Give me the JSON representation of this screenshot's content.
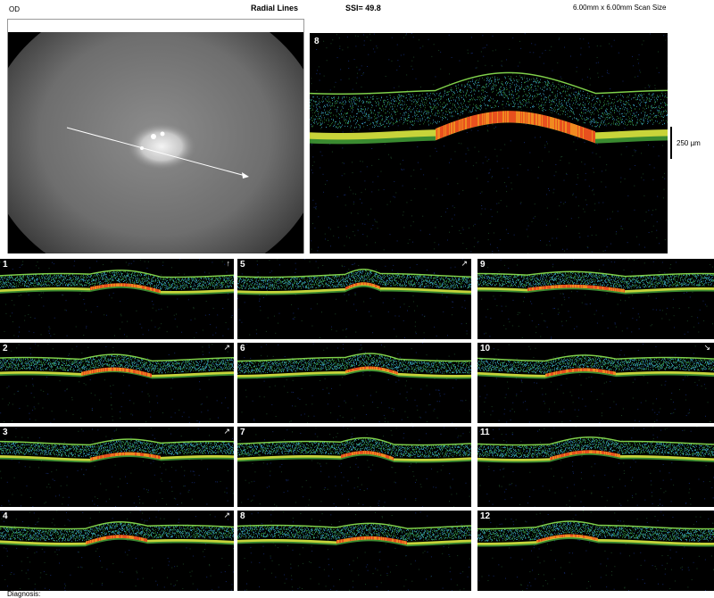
{
  "header": {
    "eye": "OD",
    "protocol": "Radial Lines",
    "ssi": "SSI= 49.8",
    "scan_size": "6.00mm x 6.00mm Scan Size"
  },
  "main_scan": {
    "label": "8"
  },
  "scale": {
    "label": "250 µm"
  },
  "thumbnails": [
    {
      "label": "1",
      "arrow": "↑"
    },
    {
      "label": "2",
      "arrow": "↗"
    },
    {
      "label": "3",
      "arrow": "↗"
    },
    {
      "label": "4",
      "arrow": "↗"
    },
    {
      "label": "5",
      "arrow": "↗"
    },
    {
      "label": "6",
      "arrow": ""
    },
    {
      "label": "7",
      "arrow": ""
    },
    {
      "label": "8",
      "arrow": ""
    },
    {
      "label": "9",
      "arrow": ""
    },
    {
      "label": "10",
      "arrow": "↘"
    },
    {
      "label": "11",
      "arrow": ""
    },
    {
      "label": "12",
      "arrow": ""
    }
  ],
  "footer": {
    "diagnosis": "Diagnosis:"
  }
}
